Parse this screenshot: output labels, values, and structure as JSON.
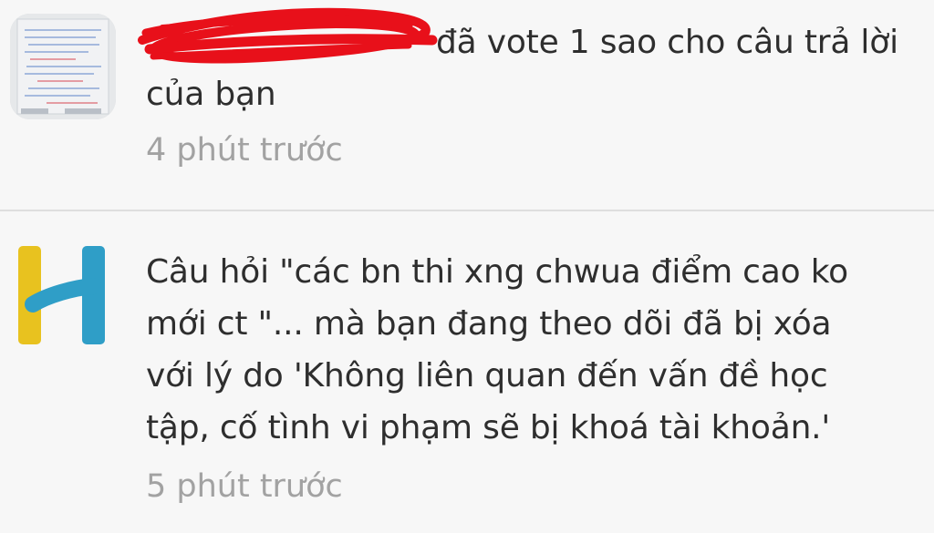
{
  "notifications": [
    {
      "avatar": "notebook-photo-avatar",
      "redacted_username": true,
      "text_line1": "đã vote 1 sao cho câu trả lời",
      "text_line2": "của bạn",
      "time": "4 phút trước"
    },
    {
      "avatar": "hoc24-h-logo",
      "text_lines": [
        "Câu hỏi \"các bn thi xng chwua điểm cao ko",
        "mới ct  \"... mà bạn đang theo dõi đã bị xóa",
        "với lý do 'Không liên quan đến vấn đề học",
        "tập, cố tình vi phạm sẽ bị khoá tài khoản.'"
      ],
      "time": "5 phút trước"
    }
  ],
  "colors": {
    "redaction": "#e8101a",
    "logo_yellow": "#e8c21f",
    "logo_blue": "#2f9ec7",
    "timestamp": "#a2a2a2",
    "divider": "#dedede"
  }
}
